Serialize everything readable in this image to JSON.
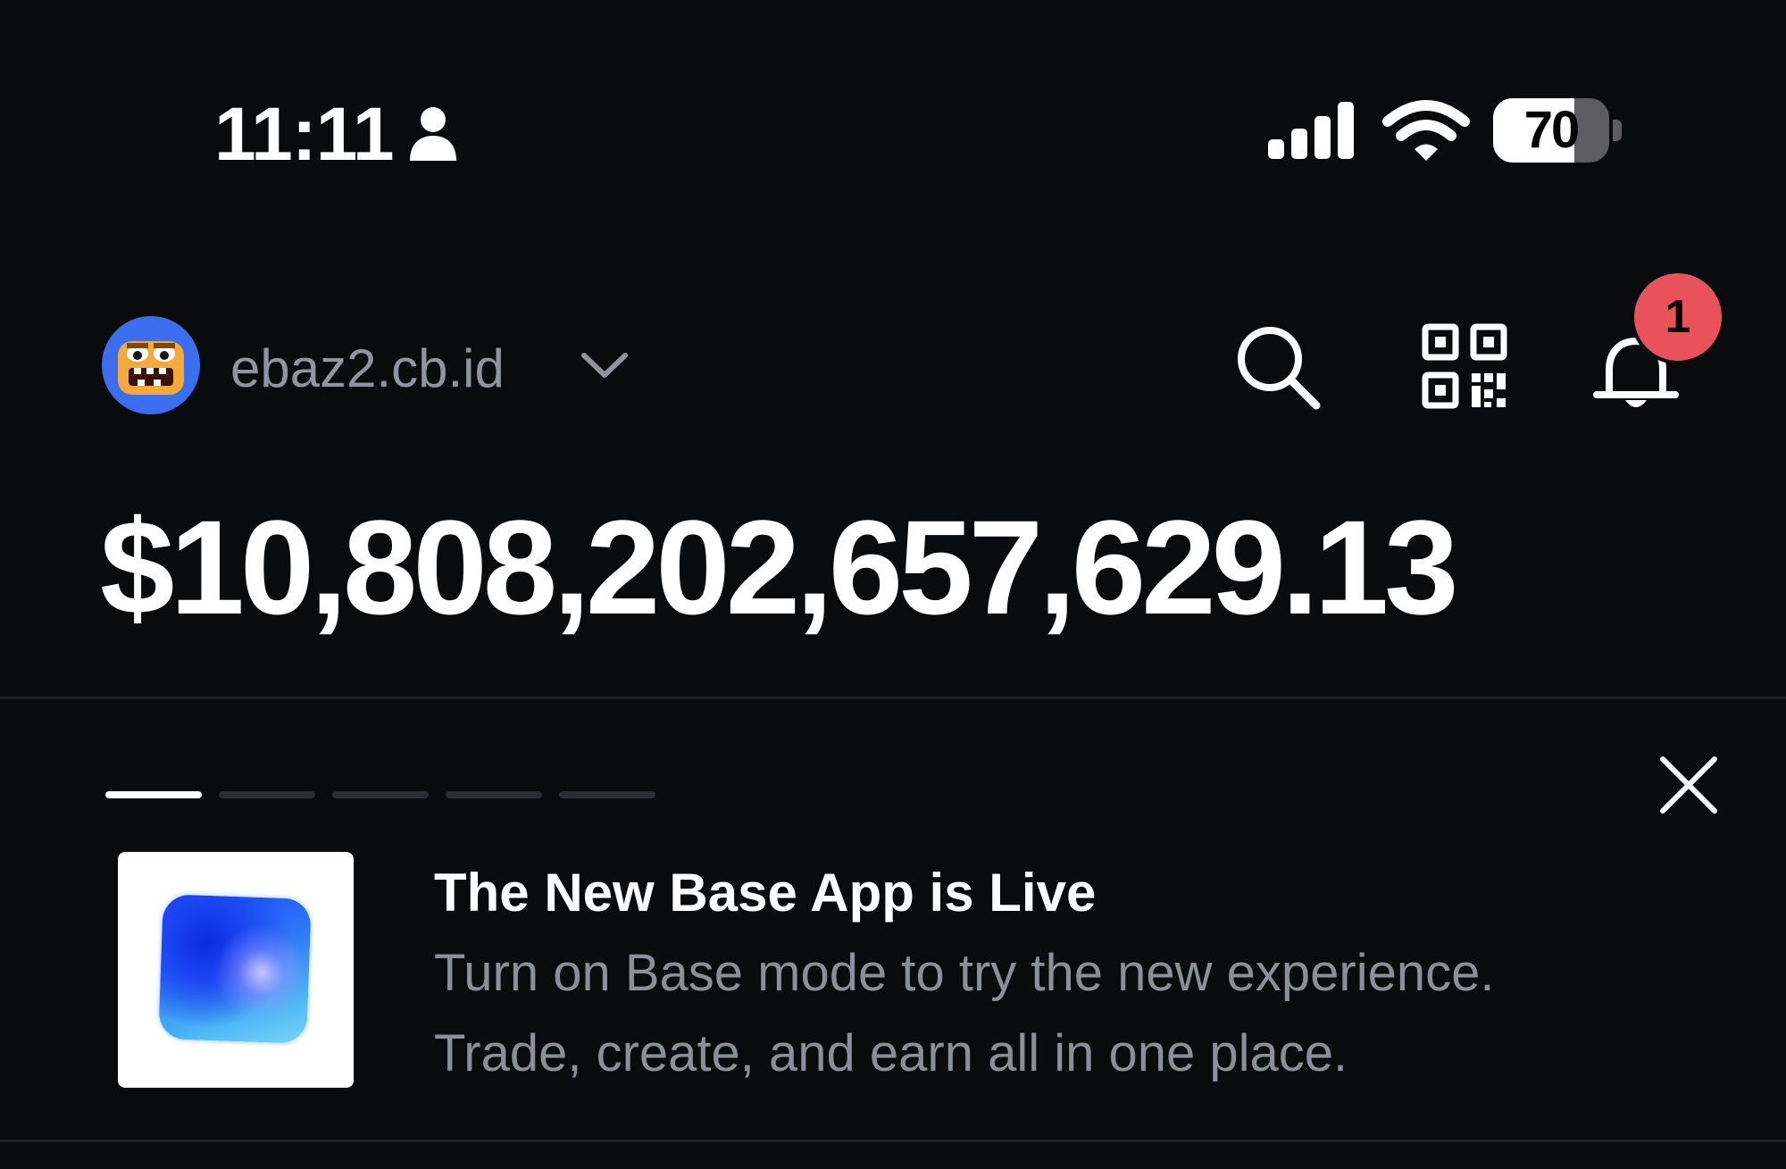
{
  "status_bar": {
    "time": "11:11",
    "icons": [
      "person-icon",
      "signal-icon",
      "wifi-icon"
    ],
    "battery_level": "70",
    "battery_fraction": 0.7
  },
  "header": {
    "account_name": "ebaz2.cb.id",
    "icons": [
      "search-icon",
      "qr-code-icon",
      "bell-icon"
    ],
    "notification_count": "1",
    "badge_color": "#e9525b",
    "avatar_color": "#3b6ff0"
  },
  "balance": {
    "amount": "$10,808,202,657,629.13"
  },
  "promo": {
    "carousel_total": 5,
    "carousel_active_index": 0,
    "title": "The New Base App is Live",
    "description_line1": "Turn on Base mode to try the new experience.",
    "description_line2": "Trade, create, and earn all in one place."
  }
}
